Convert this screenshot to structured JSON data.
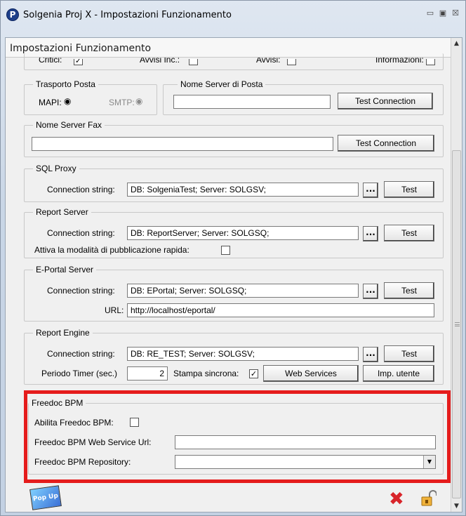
{
  "window": {
    "title": "Solgenia Proj X - Impostazioni Funzionamento",
    "app_icon_letter": "P",
    "controls": {
      "minimize": "▭",
      "restore": "▣",
      "close": "☒"
    }
  },
  "header": {
    "title": "Impostazioni Funzionamento"
  },
  "top_row": {
    "critici_label": "Critici:",
    "avvisi_inc_label": "Avvisi Inc.:",
    "avvisi_label": "Avvisi:",
    "informazioni_label": "Informazioni:"
  },
  "trasporto_posta": {
    "legend": "Trasporto Posta",
    "mapi_label": "MAPI:",
    "smtp_label": "SMTP:"
  },
  "nome_server_posta": {
    "legend": "Nome Server di Posta",
    "value": "",
    "button": "Test Connection"
  },
  "nome_server_fax": {
    "legend": "Nome Server Fax",
    "value": "",
    "button": "Test Connection"
  },
  "sql_proxy": {
    "legend": "SQL Proxy",
    "conn_label": "Connection string:",
    "conn_value": "DB: SolgeniaTest; Server: SOLGSV;",
    "dots": "...",
    "test_button": "Test"
  },
  "report_server": {
    "legend": "Report Server",
    "conn_label": "Connection string:",
    "conn_value": "DB: ReportServer; Server: SOLGSQ;",
    "dots": "...",
    "test_button": "Test",
    "rapid_label": "Attiva la modalità di pubblicazione rapida:"
  },
  "eportal": {
    "legend": "E-Portal Server",
    "conn_label": "Connection string:",
    "conn_value": "DB: EPortal; Server: SOLGSQ;",
    "dots": "...",
    "test_button": "Test",
    "url_label": "URL:",
    "url_value": "http://localhost/eportal/"
  },
  "report_engine": {
    "legend": "Report Engine",
    "conn_label": "Connection string:",
    "conn_value": "DB: RE_TEST; Server: SOLGSV;",
    "dots": "...",
    "test_button": "Test",
    "timer_label": "Periodo Timer (sec.)",
    "timer_value": "2",
    "stampa_label": "Stampa sincrona:",
    "web_services_button": "Web Services",
    "imp_utente_button": "Imp. utente"
  },
  "freedoc": {
    "legend": "Freedoc BPM",
    "abilita_label": "Abilita Freedoc BPM:",
    "url_label": "Freedoc BPM Web Service Url:",
    "url_value": "",
    "repo_label": "Freedoc BPM Repository:",
    "repo_value": ""
  },
  "footer": {
    "popup_icon_text": "Pop Up"
  },
  "colors": {
    "highlight": "#e51c1c",
    "delete_icon": "#d8242a"
  }
}
